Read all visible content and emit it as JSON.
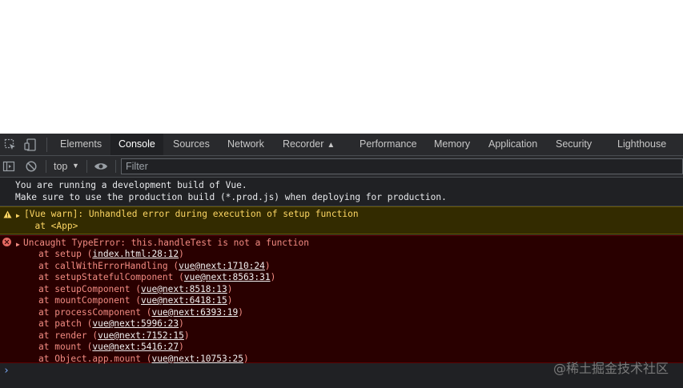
{
  "toolbar_tabs": [
    {
      "label": "Elements"
    },
    {
      "label": "Console"
    },
    {
      "label": "Sources"
    },
    {
      "label": "Network"
    },
    {
      "label": "Recorder"
    },
    {
      "label": "Performance"
    },
    {
      "label": "Memory"
    },
    {
      "label": "Application"
    },
    {
      "label": "Security"
    },
    {
      "label": "Lighthouse"
    }
  ],
  "active_tab": "Console",
  "console_toolbar": {
    "context": "top",
    "filter_placeholder": "Filter"
  },
  "messages": {
    "info": {
      "line1": "You are running a development build of Vue.",
      "line2": "Make sure to use the production build (*.prod.js) when deploying for production."
    },
    "warning": {
      "line1": "[Vue warn]: Unhandled error during execution of setup function",
      "line2": "  at <App>"
    },
    "error": {
      "title": "Uncaught TypeError: this.handleTest is not a function",
      "stack": [
        {
          "fn": "at setup (",
          "loc": "index.html:28:12",
          "end": ")"
        },
        {
          "fn": "at callWithErrorHandling (",
          "loc": "vue@next:1710:24",
          "end": ")"
        },
        {
          "fn": "at setupStatefulComponent (",
          "loc": "vue@next:8563:31",
          "end": ")"
        },
        {
          "fn": "at setupComponent (",
          "loc": "vue@next:8518:13",
          "end": ")"
        },
        {
          "fn": "at mountComponent (",
          "loc": "vue@next:6418:15",
          "end": ")"
        },
        {
          "fn": "at processComponent (",
          "loc": "vue@next:6393:19",
          "end": ")"
        },
        {
          "fn": "at patch (",
          "loc": "vue@next:5996:23",
          "end": ")"
        },
        {
          "fn": "at render (",
          "loc": "vue@next:7152:15",
          "end": ")"
        },
        {
          "fn": "at mount (",
          "loc": "vue@next:5416:27",
          "end": ")"
        },
        {
          "fn": "at Object.app.mount (",
          "loc": "vue@next:10753:25",
          "end": ")"
        }
      ]
    }
  },
  "prompt_symbol": "›",
  "watermark": "@稀土掘金技术社区",
  "colors": {
    "panel_bg": "#202124",
    "warn_bg": "#332b00",
    "warn_text": "#fdd663",
    "error_bg": "#290000",
    "error_text": "#f28b82"
  }
}
